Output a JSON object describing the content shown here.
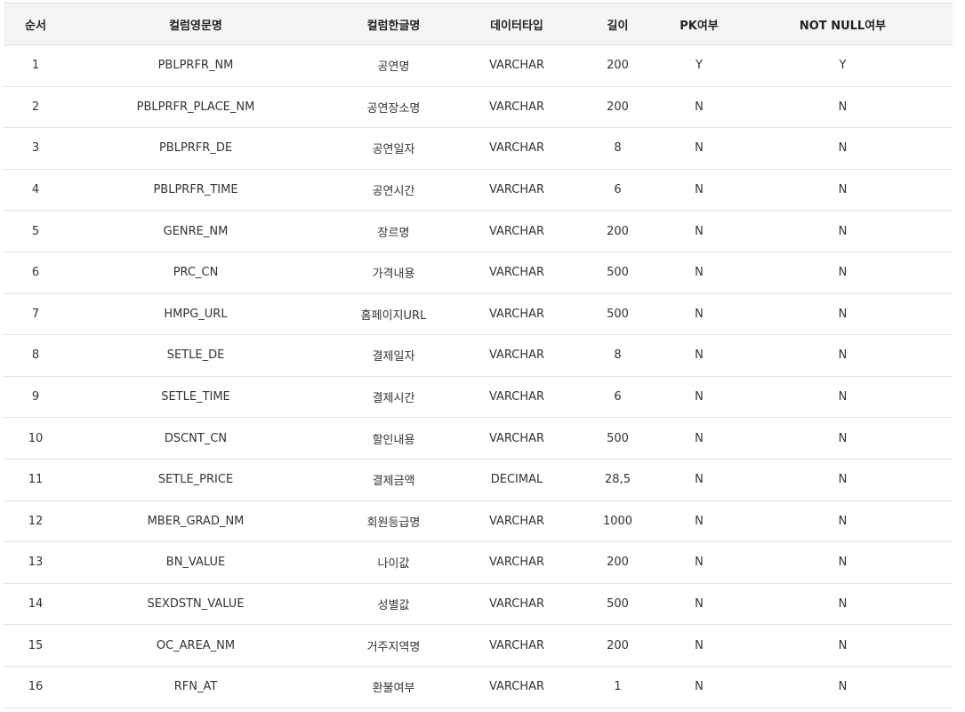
{
  "table": {
    "headers": [
      "순서",
      "컬럼영문명",
      "컬럼한글명",
      "데이터타입",
      "길이",
      "PK여부",
      "NOT NULL여부"
    ],
    "rows": [
      [
        "1",
        "PBLPRFR_NM",
        "공연명",
        "VARCHAR",
        "200",
        "Y",
        "Y"
      ],
      [
        "2",
        "PBLPRFR_PLACE_NM",
        "공연장소명",
        "VARCHAR",
        "200",
        "N",
        "N"
      ],
      [
        "3",
        "PBLPRFR_DE",
        "공연일자",
        "VARCHAR",
        "8",
        "N",
        "N"
      ],
      [
        "4",
        "PBLPRFR_TIME",
        "공연시간",
        "VARCHAR",
        "6",
        "N",
        "N"
      ],
      [
        "5",
        "GENRE_NM",
        "장르명",
        "VARCHAR",
        "200",
        "N",
        "N"
      ],
      [
        "6",
        "PRC_CN",
        "가격내용",
        "VARCHAR",
        "500",
        "N",
        "N"
      ],
      [
        "7",
        "HMPG_URL",
        "홈페이지URL",
        "VARCHAR",
        "500",
        "N",
        "N"
      ],
      [
        "8",
        "SETLE_DE",
        "결제일자",
        "VARCHAR",
        "8",
        "N",
        "N"
      ],
      [
        "9",
        "SETLE_TIME",
        "결제시간",
        "VARCHAR",
        "6",
        "N",
        "N"
      ],
      [
        "10",
        "DSCNT_CN",
        "할인내용",
        "VARCHAR",
        "500",
        "N",
        "N"
      ],
      [
        "11",
        "SETLE_PRICE",
        "결제금액",
        "DECIMAL",
        "28,5",
        "N",
        "N"
      ],
      [
        "12",
        "MBER_GRAD_NM",
        "회원등급명",
        "VARCHAR",
        "1000",
        "N",
        "N"
      ],
      [
        "13",
        "BN_VALUE",
        "나이값",
        "VARCHAR",
        "200",
        "N",
        "N"
      ],
      [
        "14",
        "SEXDSTN_VALUE",
        "성별값",
        "VARCHAR",
        "500",
        "N",
        "N"
      ],
      [
        "15",
        "OC_AREA_NM",
        "거주지역명",
        "VARCHAR",
        "200",
        "N",
        "N"
      ],
      [
        "16",
        "RFN_AT",
        "환불여부",
        "VARCHAR",
        "1",
        "N",
        "N"
      ]
    ]
  }
}
